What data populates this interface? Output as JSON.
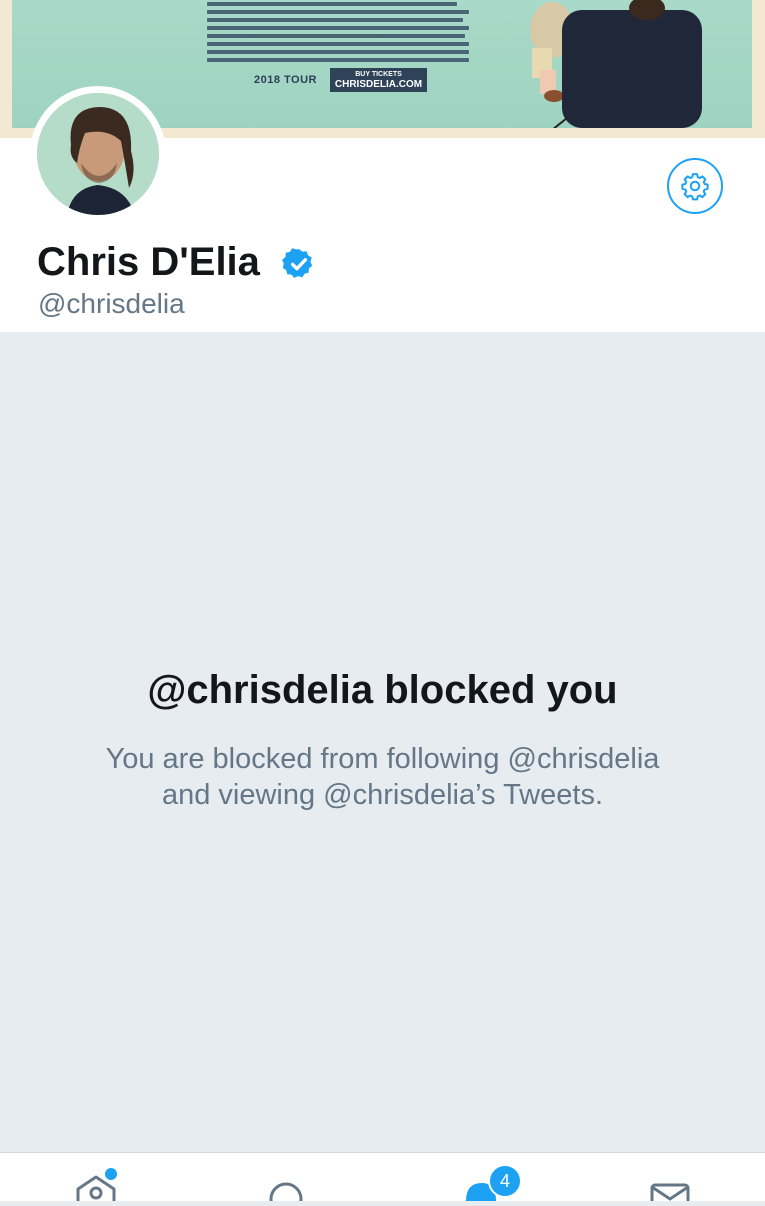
{
  "banner": {
    "tour_label": "2018 TOUR",
    "buy_label": "BUY TICKETS",
    "site": "CHRISDELIA.COM"
  },
  "profile": {
    "display_name": "Chris D'Elia",
    "handle": "@chrisdelia",
    "verified": true
  },
  "blocked": {
    "title": "@chrisdelia blocked you",
    "line1": "You are blocked from following @chrisdelia",
    "line2": "and viewing @chrisdelia’s Tweets."
  },
  "tabbar": {
    "tabs": [
      {
        "icon": "home-icon",
        "has_dot": true
      },
      {
        "icon": "search-icon"
      },
      {
        "icon": "notifications-icon",
        "badge": "4"
      },
      {
        "icon": "messages-icon"
      }
    ]
  },
  "colors": {
    "accent": "#1da1f2",
    "text_primary": "#14171a",
    "text_secondary": "#657786",
    "page_bg": "#e6ecf0"
  }
}
